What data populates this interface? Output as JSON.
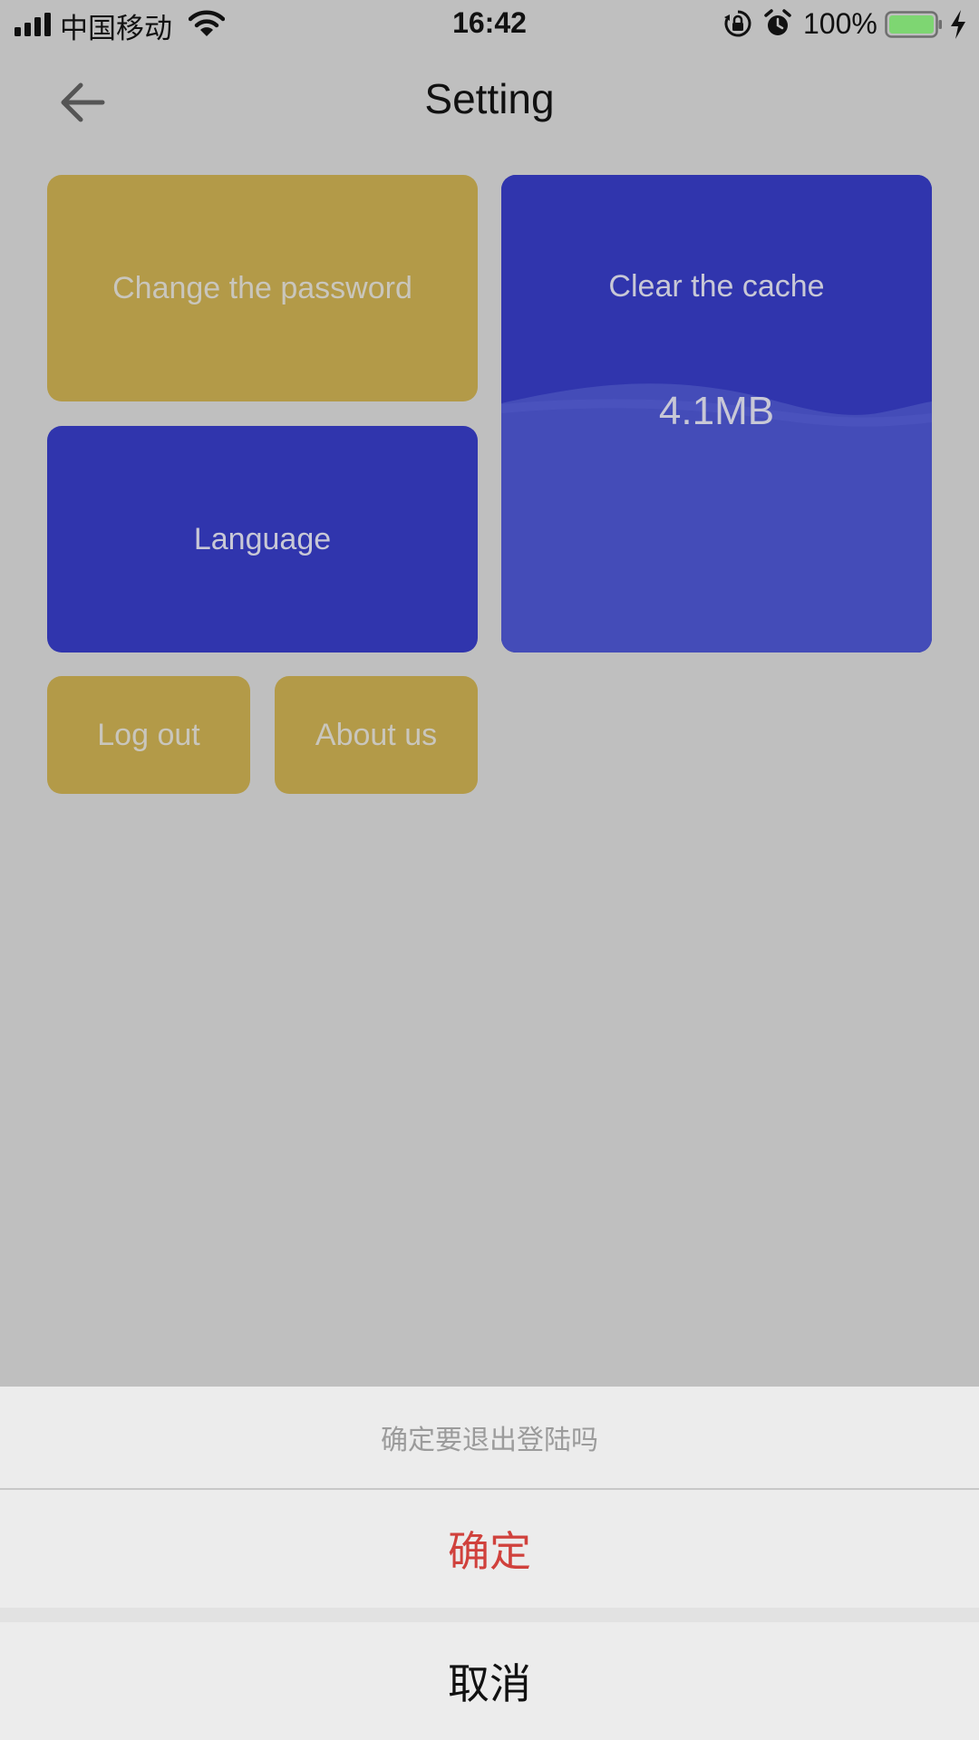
{
  "status_bar": {
    "carrier": "中国移动",
    "time": "16:42",
    "battery_percent": "100%",
    "icons": [
      "signal-icon",
      "wifi-icon",
      "rotation-lock-icon",
      "alarm-icon",
      "battery-icon",
      "charging-icon"
    ],
    "battery_color": "#7ed672"
  },
  "header": {
    "title": "Setting",
    "back_icon": "arrow-left-icon"
  },
  "tiles": {
    "change_password": "Change the password",
    "clear_cache": "Clear the cache",
    "cache_size": "4.1MB",
    "language": "Language",
    "log_out": "Log out",
    "about_us": "About us"
  },
  "colors": {
    "gold": "#b39a48",
    "blue": "#3035ad",
    "wave_blue": "#444cb8",
    "confirm_red": "#d0413c"
  },
  "action_sheet": {
    "title": "确定要退出登陆吗",
    "confirm_label": "确定",
    "cancel_label": "取消"
  }
}
